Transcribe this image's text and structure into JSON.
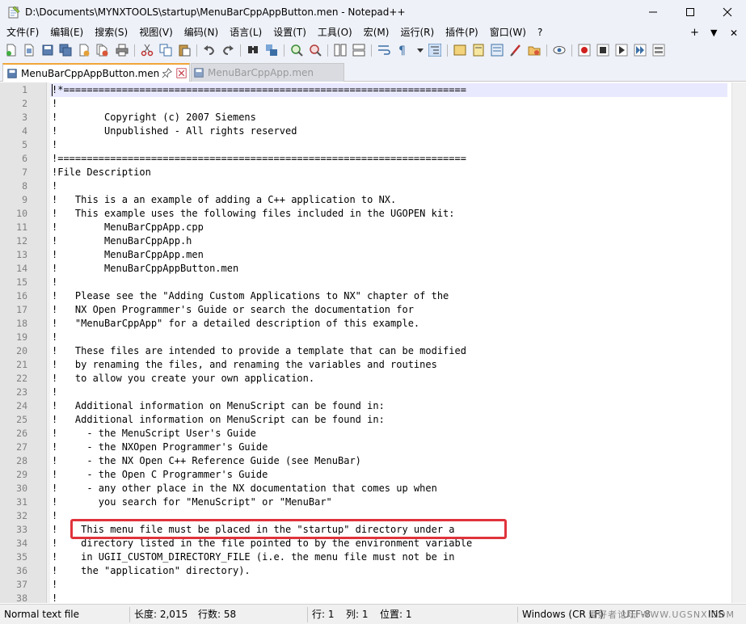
{
  "window": {
    "title": "D:\\Documents\\MYNXTOOLS\\startup\\MenuBarCppAppButton.men - Notepad++",
    "app_icon": "notepad-icon"
  },
  "menubar": {
    "items": [
      "文件(F)",
      "编辑(E)",
      "搜索(S)",
      "视图(V)",
      "编码(N)",
      "语言(L)",
      "设置(T)",
      "工具(O)",
      "宏(M)",
      "运行(R)",
      "插件(P)",
      "窗口(W)",
      "?"
    ],
    "right_plus": "+",
    "right_down": "▼",
    "right_close": "✕"
  },
  "tabs": [
    {
      "label": "MenuBarCppAppButton.men",
      "active": true
    },
    {
      "label": "MenuBarCppApp.men",
      "active": false
    }
  ],
  "editor": {
    "lines": [
      "!*=====================================================================",
      "!",
      "!        Copyright (c) 2007 Siemens",
      "!        Unpublished - All rights reserved",
      "!",
      "!======================================================================",
      "!File Description",
      "!",
      "!   This is a an example of adding a C++ application to NX.",
      "!   This example uses the following files included in the UGOPEN kit:",
      "!        MenuBarCppApp.cpp",
      "!        MenuBarCppApp.h",
      "!        MenuBarCppApp.men",
      "!        MenuBarCppAppButton.men",
      "!",
      "!   Please see the \"Adding Custom Applications to NX\" chapter of the",
      "!   NX Open Programmer's Guide or search the documentation for",
      "!   \"MenuBarCppApp\" for a detailed description of this example.",
      "!",
      "!   These files are intended to provide a template that can be modified",
      "!   by renaming the files, and renaming the variables and routines",
      "!   to allow you create your own application.",
      "!",
      "!   Additional information on MenuScript can be found in:",
      "!   Additional information on MenuScript can be found in:",
      "!     - the MenuScript User's Guide",
      "!     - the NXOpen Programmer's Guide",
      "!     - the NX Open C++ Reference Guide (see MenuBar)",
      "!     - the Open C Programmer's Guide",
      "!     - any other place in the NX documentation that comes up when",
      "!       you search for \"MenuScript\" or \"MenuBar\"",
      "!",
      "!    This menu file must be placed in the \"startup\" directory under a",
      "!    directory listed in the file pointed to by the environment variable",
      "!    in UGII_CUSTOM_DIRECTORY_FILE (i.e. the menu file must not be in",
      "!    the \"application\" directory).",
      "!",
      "!"
    ],
    "highlight_color": "#e0333b"
  },
  "status": {
    "file_type": "Normal text file",
    "length": "长度: 2,015",
    "lines": "行数: 58",
    "line_pos": "行: 1",
    "col_pos": "列: 1",
    "position": "位置: 1",
    "eol": "Windows (CR LF)",
    "encoding": "UTF-8",
    "mode": "INS",
    "watermark": "爱好者论坛  WWW.UGSNX.COM"
  }
}
